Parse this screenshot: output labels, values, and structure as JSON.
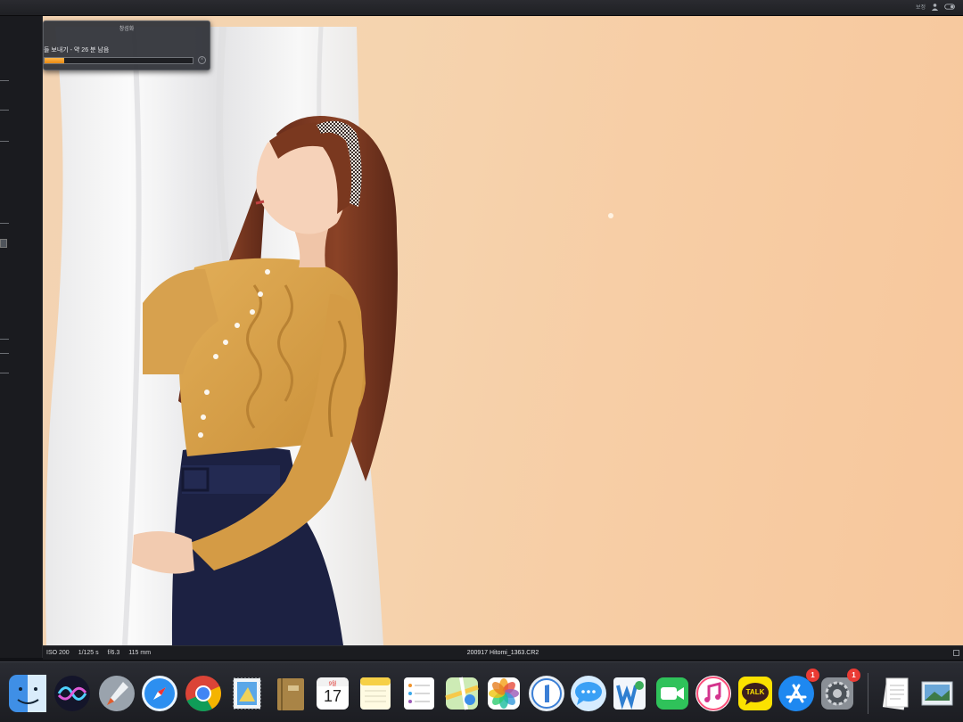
{
  "topbar": {
    "label": "보정"
  },
  "export_dialog": {
    "title": "창섬화",
    "status": "들 보내기 - 약 26 분 남음",
    "progress": 0.13
  },
  "info_bar": {
    "iso": "ISO 200",
    "shutter": "1/125 s",
    "aperture": "f/6.3",
    "focal": "115 mm",
    "filename": "200917 Hitomi_1363.CR2"
  },
  "dock": {
    "calendar_month": "9월",
    "calendar_day": "17",
    "kakao_label": "TALK",
    "app_store_badge": "1",
    "settings_badge": "1"
  },
  "colors": {
    "accent": "#f39a1d",
    "sweater": "#d9a24a",
    "skirt": "#1b2040",
    "background": "#f5d2ad"
  }
}
